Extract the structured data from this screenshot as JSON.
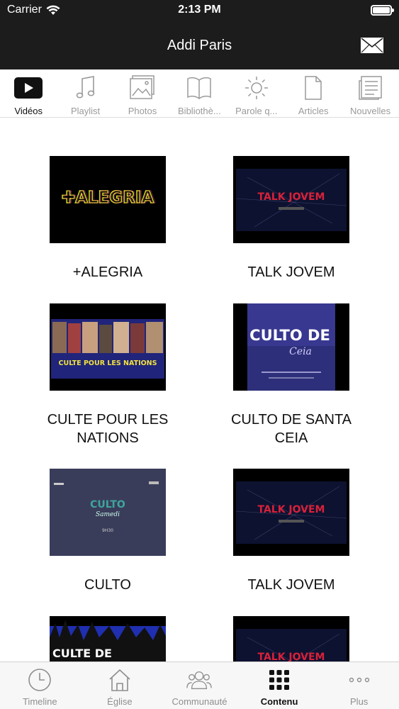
{
  "status_bar": {
    "carrier": "Carrier",
    "time": "2:13 PM"
  },
  "nav": {
    "title": "Addi Paris",
    "mail_icon": "envelope-icon"
  },
  "categories": [
    {
      "label": "Vidéos",
      "icon": "play-icon",
      "active": true
    },
    {
      "label": "Playlist",
      "icon": "music-note-icon",
      "active": false
    },
    {
      "label": "Photos",
      "icon": "photos-icon",
      "active": false
    },
    {
      "label": "Bibliothè...",
      "icon": "book-icon",
      "active": false
    },
    {
      "label": "Parole q...",
      "icon": "sun-icon",
      "active": false
    },
    {
      "label": "Articles",
      "icon": "document-icon",
      "active": false
    },
    {
      "label": "Nouvelles",
      "icon": "news-icon",
      "active": false
    }
  ],
  "videos": [
    {
      "title": "+ALEGRIA",
      "thumb_text": "✚ALEGRIA"
    },
    {
      "title": "TALK JOVEM",
      "thumb_text": "TALK JOVEM"
    },
    {
      "title": "CULTE POUR LES NATIONS",
      "thumb_text": "CULTE POUR LES NATIONS"
    },
    {
      "title": "CULTO DE SANTA CEIA",
      "thumb_text": "CULTO DE",
      "thumb_text_2": "Ceia"
    },
    {
      "title": "CULTO",
      "thumb_text": "CULTO",
      "thumb_text_2": "Samedi",
      "thumb_text_3": "9H30"
    },
    {
      "title": "TALK JOVEM",
      "thumb_text": "TALK JOVEM"
    },
    {
      "title": "",
      "thumb_text": "CULTE DE"
    },
    {
      "title": "",
      "thumb_text": "TALK JOVEM"
    }
  ],
  "tabbar": [
    {
      "label": "Timeline",
      "icon": "clock-icon",
      "active": false
    },
    {
      "label": "Église",
      "icon": "church-icon",
      "active": false
    },
    {
      "label": "Communauté",
      "icon": "people-icon",
      "active": false
    },
    {
      "label": "Contenu",
      "icon": "grid-icon",
      "active": true
    },
    {
      "label": "Plus",
      "icon": "more-icon",
      "active": false
    }
  ],
  "colors": {
    "bar_dark": "#1c1c1c",
    "accent_neon_red": "#d8213a",
    "neon_yellow": "#d4e21a"
  }
}
